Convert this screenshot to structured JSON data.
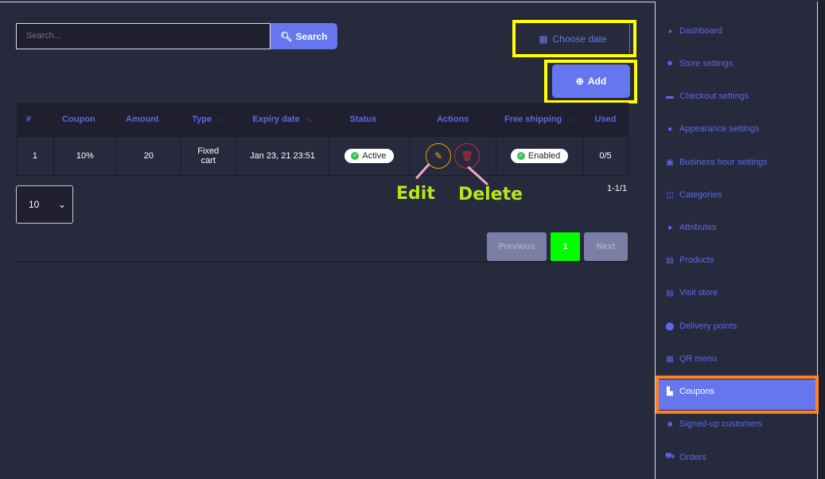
{
  "search": {
    "placeholder": "Search...",
    "button_label": "Search"
  },
  "toolbar": {
    "choose_date_label": "Choose date",
    "add_label": "Add"
  },
  "table": {
    "headers": [
      "#",
      "Coupon",
      "Amount",
      "Type",
      "Expiry date",
      "Status",
      "Actions",
      "Free shipping",
      "Used"
    ],
    "rows": [
      {
        "index": "1",
        "coupon": "10%",
        "amount": "20",
        "type_line1": "Fixed",
        "type_line2": "cart",
        "expiry": "Jan 23, 21 23:51",
        "status": "Active",
        "free_shipping": "Enabled",
        "used": "0/5"
      }
    ]
  },
  "annotations": {
    "edit": "Edit",
    "delete": "Delete"
  },
  "pagination": {
    "range": "1-1/1",
    "page_size": "10",
    "previous": "Previous",
    "current": "1",
    "next": "Next"
  },
  "sidebar": {
    "items": [
      {
        "label": "Dashboard",
        "icon": "tachometer-icon"
      },
      {
        "label": "Store settings",
        "icon": "gear-icon"
      },
      {
        "label": "Checkout settings",
        "icon": "credit-card-icon"
      },
      {
        "label": "Appearance settings",
        "icon": "palette-icon"
      },
      {
        "label": "Business hour settings",
        "icon": "calendar-check-icon"
      },
      {
        "label": "Categories",
        "icon": "columns-icon"
      },
      {
        "label": "Attributes",
        "icon": "palette-icon"
      },
      {
        "label": "Products",
        "icon": "boxes-icon"
      },
      {
        "label": "Visit store",
        "icon": "list-alt-icon"
      },
      {
        "label": "Delivery points",
        "icon": "map-marker-icon"
      },
      {
        "label": "QR menu",
        "icon": "qrcode-icon"
      },
      {
        "label": "Coupons",
        "icon": "coupon-icon",
        "active": true
      },
      {
        "label": "Signed-up customers",
        "icon": "users-icon"
      },
      {
        "label": "Orders",
        "icon": "cart-icon"
      }
    ]
  },
  "colors": {
    "accent": "#6576ee",
    "background": "#272a3d",
    "highlight_yellow": "#ffff00",
    "highlight_orange": "#ff7f27",
    "current_page": "#00ff00",
    "annotation": "#b6e61c"
  }
}
